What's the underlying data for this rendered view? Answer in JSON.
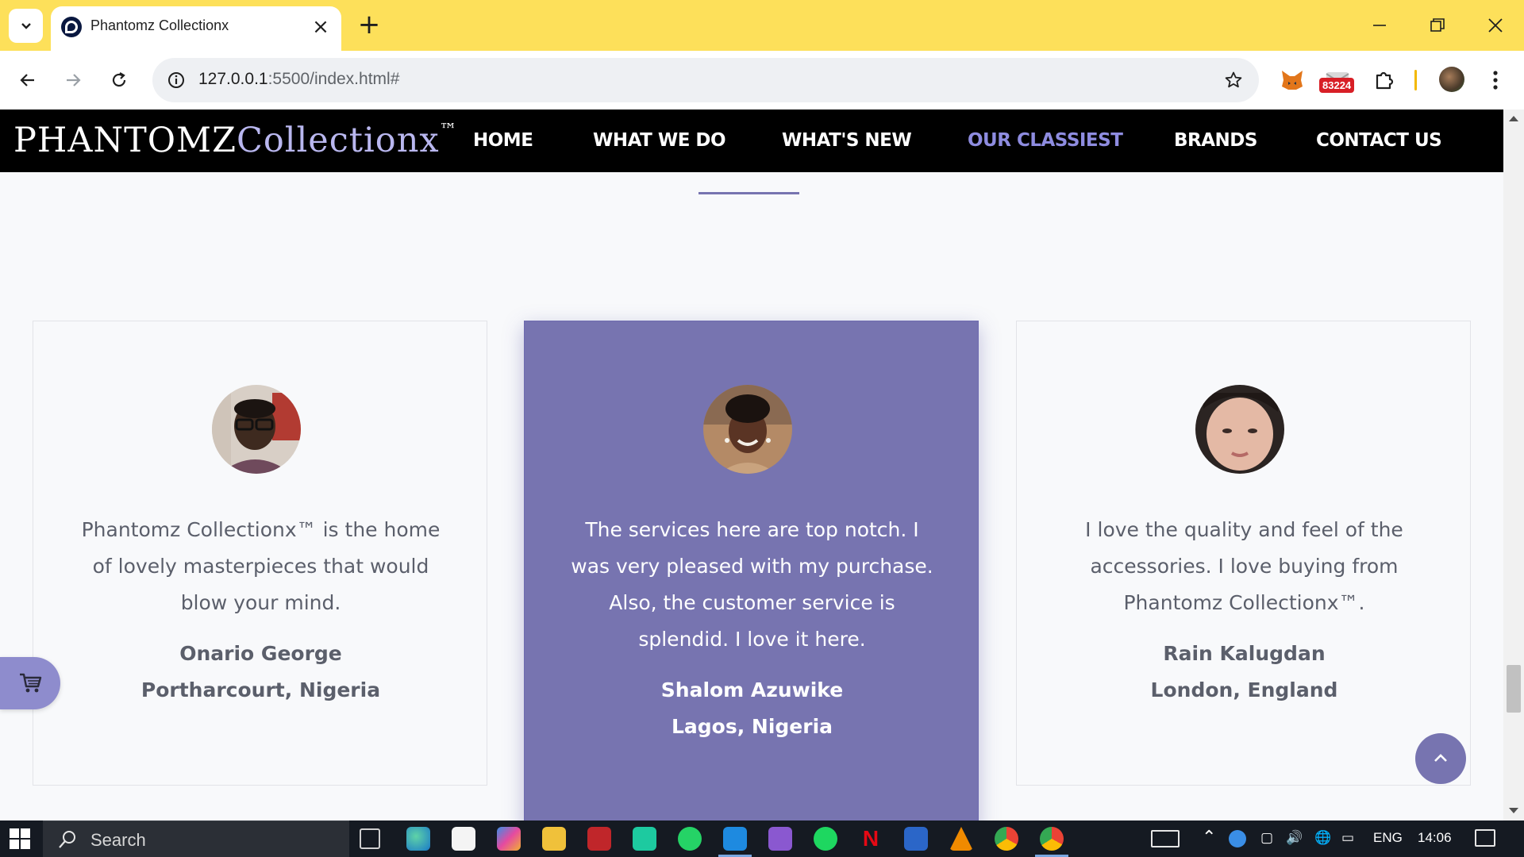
{
  "browser": {
    "tab_title": "Phantomz Collectionx",
    "url_host": "127.0.0.1",
    "url_rest": ":5500/index.html#",
    "extension_badge": "83224"
  },
  "site": {
    "brand_main": "PHANTOMZ",
    "brand_accent": "Collectionx",
    "brand_mark": "™",
    "nav": [
      {
        "label": "HOME",
        "active": false
      },
      {
        "label": "WHAT WE DO",
        "active": false
      },
      {
        "label": "WHAT'S NEW",
        "active": false
      },
      {
        "label": "OUR CLASSIEST",
        "active": true
      },
      {
        "label": "BRANDS",
        "active": false
      },
      {
        "label": "CONTACT US",
        "active": false
      }
    ],
    "accent_color": "#7774b0"
  },
  "testimonials": [
    {
      "quote": "Phantomz Collectionx™ is the home of lovely masterpieces that would blow your mind.",
      "name": "Onario George",
      "place": "Portharcourt, Nigeria",
      "featured": false
    },
    {
      "quote": "The services here are top notch. I was very pleased with my purchase. Also, the customer service is splendid. I love it here.",
      "name": "Shalom Azuwike",
      "place": "Lagos, Nigeria",
      "featured": true
    },
    {
      "quote": "I love the quality and feel of the accessories. I love buying from Phantomz Collectionx™.",
      "name": "Rain Kalugdan",
      "place": "London, England",
      "featured": false
    }
  ],
  "taskbar": {
    "search_placeholder": "Search",
    "language": "ENG",
    "time": "14:06"
  }
}
